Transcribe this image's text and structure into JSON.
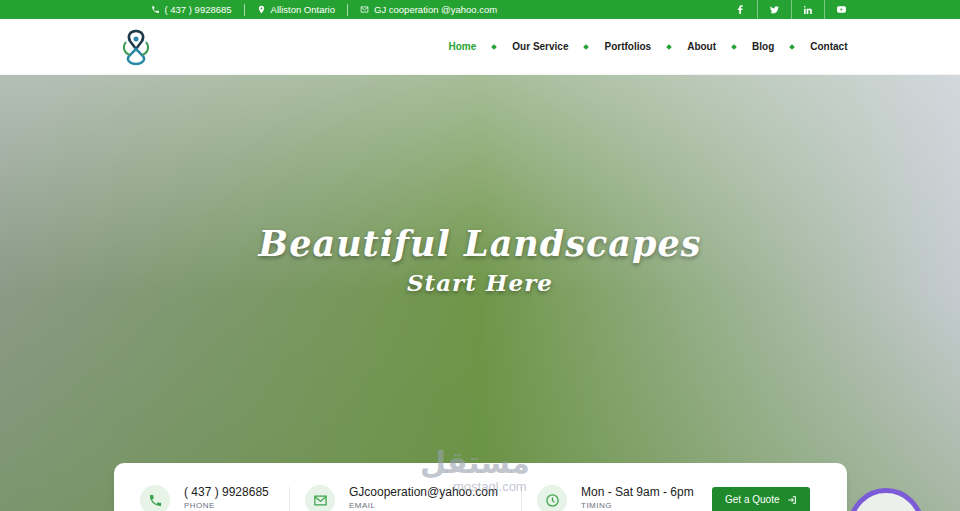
{
  "topbar": {
    "items": [
      {
        "text": "( 437 ) 9928685",
        "kind": "phone"
      },
      {
        "text": "Alliston Ontario",
        "kind": "location"
      },
      {
        "text": "GJ cooperation @yahoo.com",
        "kind": "email"
      }
    ]
  },
  "nav": [
    {
      "label": "Home",
      "selected": true
    },
    {
      "label": "Our Service",
      "selected": false
    },
    {
      "label": "Portfolios",
      "selected": false
    },
    {
      "label": "About",
      "selected": false
    },
    {
      "label": "Blog",
      "selected": false
    },
    {
      "label": "Contact",
      "selected": false
    }
  ],
  "hero": {
    "title": "Beautiful Landscapes",
    "subtitle": "Start Here"
  },
  "contact_card": {
    "items": [
      {
        "value": "( 437 ) 9928685",
        "label": "PHONE",
        "kind": "phone"
      },
      {
        "value": "GJcooperation@yahoo.com",
        "label": "EMAIL",
        "kind": "email"
      },
      {
        "value": "Mon - Sat 9am - 6pm",
        "label": "TIMING",
        "kind": "clock"
      }
    ],
    "button": "Get a Quote"
  },
  "watermark": {
    "text": "مستقل",
    "sub": "mostaql.com"
  }
}
